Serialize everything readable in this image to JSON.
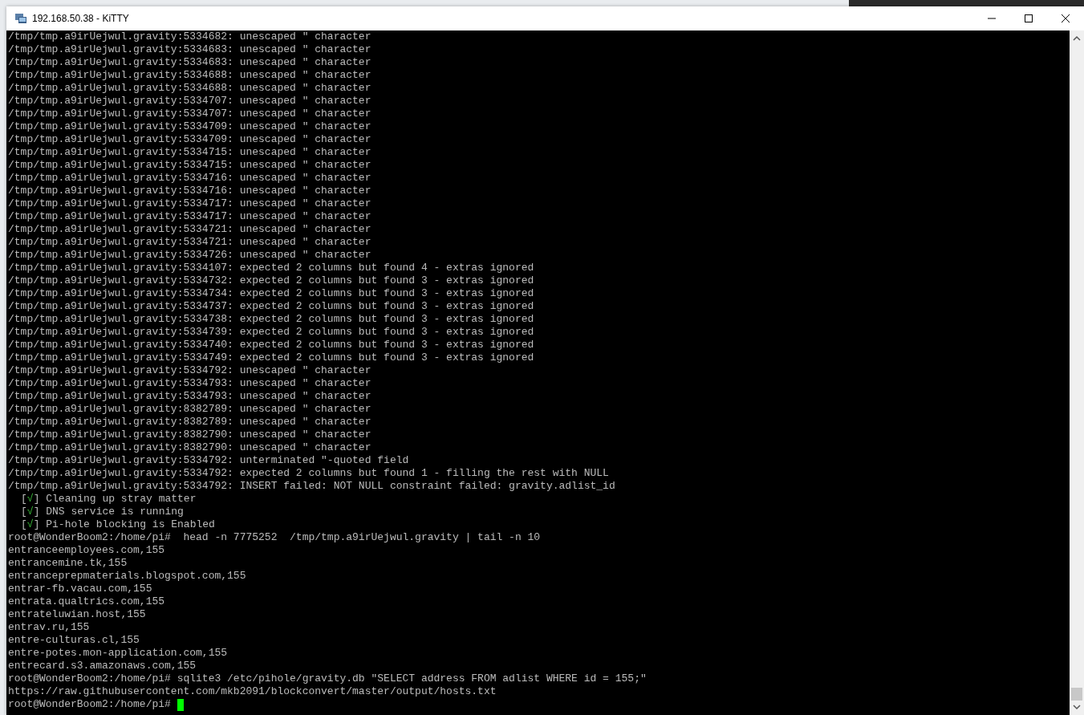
{
  "window": {
    "title": "192.168.50.38 - KiTTY"
  },
  "terminal": {
    "lines": [
      {
        "kind": "text",
        "text": "/tmp/tmp.a9irUejwul.gravity:5334682: unescaped \" character"
      },
      {
        "kind": "text",
        "text": "/tmp/tmp.a9irUejwul.gravity:5334683: unescaped \" character"
      },
      {
        "kind": "text",
        "text": "/tmp/tmp.a9irUejwul.gravity:5334683: unescaped \" character"
      },
      {
        "kind": "text",
        "text": "/tmp/tmp.a9irUejwul.gravity:5334688: unescaped \" character"
      },
      {
        "kind": "text",
        "text": "/tmp/tmp.a9irUejwul.gravity:5334688: unescaped \" character"
      },
      {
        "kind": "text",
        "text": "/tmp/tmp.a9irUejwul.gravity:5334707: unescaped \" character"
      },
      {
        "kind": "text",
        "text": "/tmp/tmp.a9irUejwul.gravity:5334707: unescaped \" character"
      },
      {
        "kind": "text",
        "text": "/tmp/tmp.a9irUejwul.gravity:5334709: unescaped \" character"
      },
      {
        "kind": "text",
        "text": "/tmp/tmp.a9irUejwul.gravity:5334709: unescaped \" character"
      },
      {
        "kind": "text",
        "text": "/tmp/tmp.a9irUejwul.gravity:5334715: unescaped \" character"
      },
      {
        "kind": "text",
        "text": "/tmp/tmp.a9irUejwul.gravity:5334715: unescaped \" character"
      },
      {
        "kind": "text",
        "text": "/tmp/tmp.a9irUejwul.gravity:5334716: unescaped \" character"
      },
      {
        "kind": "text",
        "text": "/tmp/tmp.a9irUejwul.gravity:5334716: unescaped \" character"
      },
      {
        "kind": "text",
        "text": "/tmp/tmp.a9irUejwul.gravity:5334717: unescaped \" character"
      },
      {
        "kind": "text",
        "text": "/tmp/tmp.a9irUejwul.gravity:5334717: unescaped \" character"
      },
      {
        "kind": "text",
        "text": "/tmp/tmp.a9irUejwul.gravity:5334721: unescaped \" character"
      },
      {
        "kind": "text",
        "text": "/tmp/tmp.a9irUejwul.gravity:5334721: unescaped \" character"
      },
      {
        "kind": "text",
        "text": "/tmp/tmp.a9irUejwul.gravity:5334726: unescaped \" character"
      },
      {
        "kind": "text",
        "text": "/tmp/tmp.a9irUejwul.gravity:5334107: expected 2 columns but found 4 - extras ignored"
      },
      {
        "kind": "text",
        "text": "/tmp/tmp.a9irUejwul.gravity:5334732: expected 2 columns but found 3 - extras ignored"
      },
      {
        "kind": "text",
        "text": "/tmp/tmp.a9irUejwul.gravity:5334734: expected 2 columns but found 3 - extras ignored"
      },
      {
        "kind": "text",
        "text": "/tmp/tmp.a9irUejwul.gravity:5334737: expected 2 columns but found 3 - extras ignored"
      },
      {
        "kind": "text",
        "text": "/tmp/tmp.a9irUejwul.gravity:5334738: expected 2 columns but found 3 - extras ignored"
      },
      {
        "kind": "text",
        "text": "/tmp/tmp.a9irUejwul.gravity:5334739: expected 2 columns but found 3 - extras ignored"
      },
      {
        "kind": "text",
        "text": "/tmp/tmp.a9irUejwul.gravity:5334740: expected 2 columns but found 3 - extras ignored"
      },
      {
        "kind": "text",
        "text": "/tmp/tmp.a9irUejwul.gravity:5334749: expected 2 columns but found 3 - extras ignored"
      },
      {
        "kind": "text",
        "text": "/tmp/tmp.a9irUejwul.gravity:5334792: unescaped \" character"
      },
      {
        "kind": "text",
        "text": "/tmp/tmp.a9irUejwul.gravity:5334793: unescaped \" character"
      },
      {
        "kind": "text",
        "text": "/tmp/tmp.a9irUejwul.gravity:5334793: unescaped \" character"
      },
      {
        "kind": "text",
        "text": "/tmp/tmp.a9irUejwul.gravity:8382789: unescaped \" character"
      },
      {
        "kind": "text",
        "text": "/tmp/tmp.a9irUejwul.gravity:8382789: unescaped \" character"
      },
      {
        "kind": "text",
        "text": "/tmp/tmp.a9irUejwul.gravity:8382790: unescaped \" character"
      },
      {
        "kind": "text",
        "text": "/tmp/tmp.a9irUejwul.gravity:8382790: unescaped \" character"
      },
      {
        "kind": "text",
        "text": "/tmp/tmp.a9irUejwul.gravity:5334792: unterminated \"-quoted field"
      },
      {
        "kind": "text",
        "text": "/tmp/tmp.a9irUejwul.gravity:5334792: expected 2 columns but found 1 - filling the rest with NULL"
      },
      {
        "kind": "text",
        "text": "/tmp/tmp.a9irUejwul.gravity:5334792: INSERT failed: NOT NULL constraint failed: gravity.adlist_id"
      },
      {
        "kind": "status",
        "open": "[",
        "mark": "√",
        "close": "]",
        "text": "Cleaning up stray matter"
      },
      {
        "kind": "status",
        "open": "[",
        "mark": "√",
        "close": "]",
        "text": "DNS service is running"
      },
      {
        "kind": "status",
        "open": "[",
        "mark": "√",
        "close": "]",
        "text": "Pi-hole blocking is Enabled"
      },
      {
        "kind": "text",
        "text": "root@WonderBoom2:/home/pi#  head -n 7775252  /tmp/tmp.a9irUejwul.gravity | tail -n 10"
      },
      {
        "kind": "text",
        "text": "entranceemployees.com,155"
      },
      {
        "kind": "text",
        "text": "entrancemine.tk,155"
      },
      {
        "kind": "text",
        "text": "entranceprepmaterials.blogspot.com,155"
      },
      {
        "kind": "text",
        "text": "entrar-fb.vacau.com,155"
      },
      {
        "kind": "text",
        "text": "entrata.qualtrics.com,155"
      },
      {
        "kind": "text",
        "text": "entrateluwian.host,155"
      },
      {
        "kind": "text",
        "text": "entrav.ru,155"
      },
      {
        "kind": "text",
        "text": "entre-culturas.cl,155"
      },
      {
        "kind": "text",
        "text": "entre-potes.mon-application.com,155"
      },
      {
        "kind": "text",
        "text": "entrecard.s3.amazonaws.com,155"
      },
      {
        "kind": "text",
        "text": "root@WonderBoom2:/home/pi# sqlite3 /etc/pihole/gravity.db \"SELECT address FROM adlist WHERE id = 155;\""
      },
      {
        "kind": "text",
        "text": "https://raw.githubusercontent.com/mkb2091/blockconvert/master/output/hosts.txt"
      },
      {
        "kind": "prompt",
        "text": "root@WonderBoom2:/home/pi#",
        "cursor": true
      }
    ]
  }
}
